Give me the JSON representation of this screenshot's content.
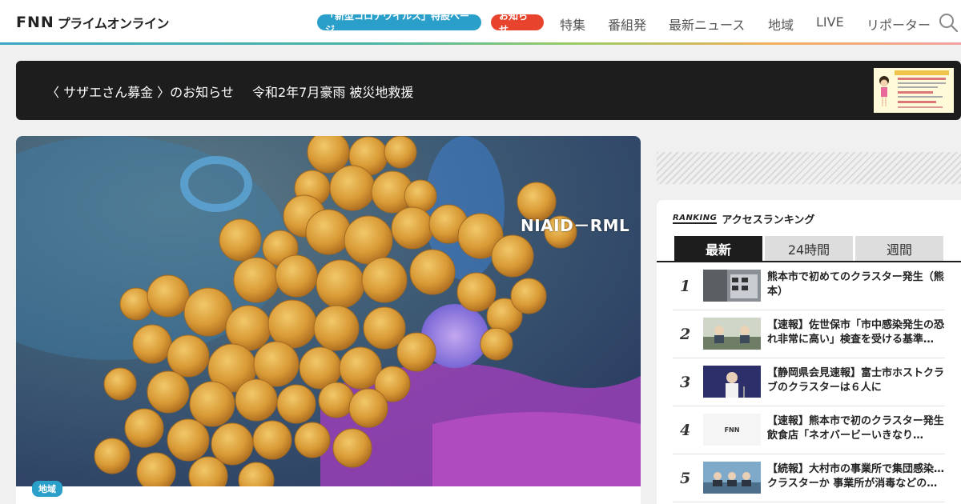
{
  "header": {
    "logo_mark": "FNN",
    "logo_text": "プライムオンライン",
    "nav": {
      "corona": "「新型コロナウイルス」特設ページ",
      "notice": "お知らせ",
      "items": [
        "特集",
        "番組発",
        "最新ニュース",
        "地域",
        "LIVE",
        "リポーター"
      ]
    }
  },
  "banner": {
    "campaign": "〈 サザエさん募金 〉のお知らせ",
    "subject": "令和2年7月豪雨 被災地救援"
  },
  "main": {
    "watermark": "NIAID－RML",
    "category": "地域"
  },
  "ranking": {
    "logo": "RANKING",
    "title": "アクセスランキング",
    "tabs": [
      "最新",
      "24時間",
      "週間"
    ],
    "active_tab": "最新",
    "items": [
      {
        "rank": "1",
        "title": "熊本市で初めてのクラスター発生（熊本）"
      },
      {
        "rank": "2",
        "title": "【速報】佐世保市「市中感染発生の恐れ非常に高い」検査を受ける基準…"
      },
      {
        "rank": "3",
        "title": "【静岡県会見速報】富士市ホストクラブのクラスターは６人に"
      },
      {
        "rank": "4",
        "title": "【速報】熊本市で初のクラスター発生　飲食店「ネオバービーいきなり…"
      },
      {
        "rank": "5",
        "title": "【続報】大村市の事業所で集団感染…クラスターか 事業所が消毒などの…"
      }
    ]
  },
  "colors": {
    "corona_pill": "#2a9fc9",
    "notice_pill": "#e8442d",
    "banner_bg": "#1d1d1d",
    "tab_active": "#1d1d1d"
  }
}
